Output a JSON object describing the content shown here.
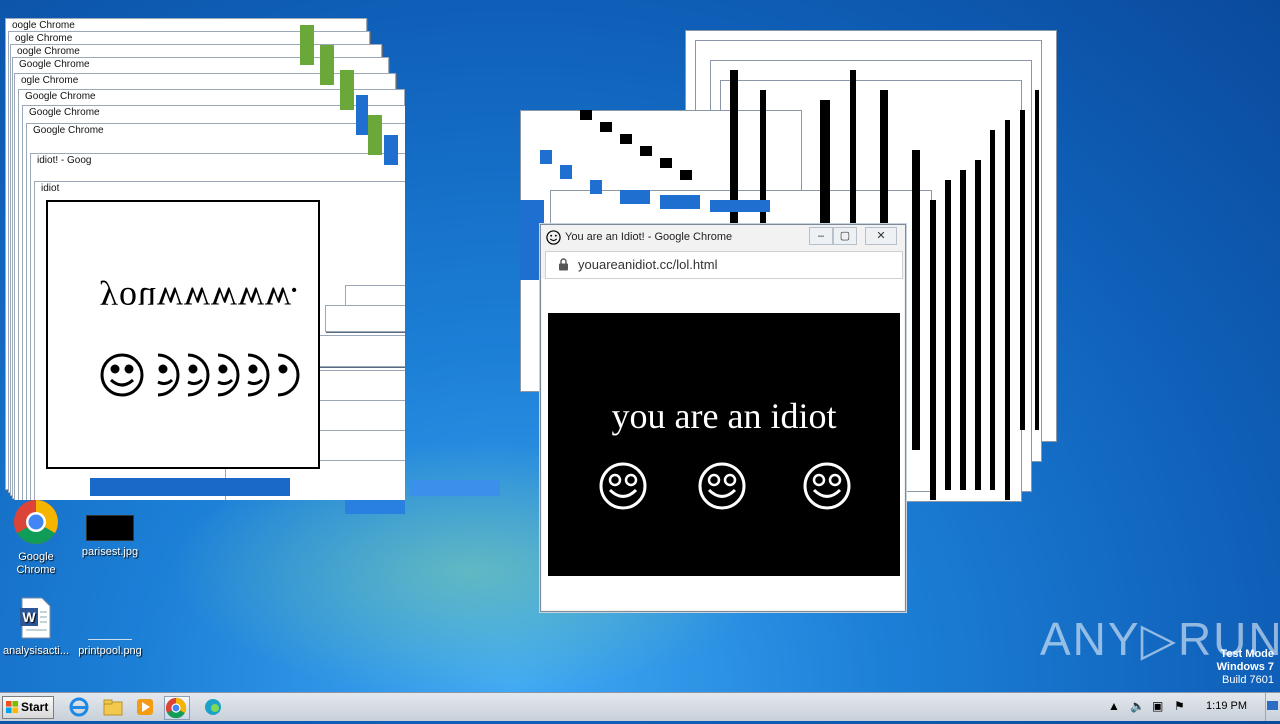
{
  "main_window": {
    "title": "You are an Idiot! - Google Chrome",
    "url": "youareanidiot.cc/lol.html",
    "headline": "you are an idiot",
    "minimize": "–",
    "maximize": "▢",
    "close": "✕"
  },
  "left_glitch": {
    "mirrored_text": "youwwwww.",
    "ghost_titles": [
      "Google Chrome",
      "oogle Chrome",
      "ogle Chrome",
      "oogle Chrome",
      "Google Chrome",
      "ogle Chrome",
      "Google Chrome",
      "Google Chrome",
      "idiot! - Goog",
      "idiot"
    ]
  },
  "desktop_icons": [
    {
      "label": "Google Chrome",
      "icon": "chrome-icon"
    },
    {
      "label": "parisest.jpg",
      "icon": "image-icon"
    },
    {
      "label": "analysisacti...",
      "icon": "word-doc-icon"
    },
    {
      "label": "printpool.png",
      "icon": "image-icon"
    }
  ],
  "watermark": {
    "brand": "ANY▷RUN",
    "mode": "Test Mode",
    "os": "Windows 7",
    "build": "Build 7601"
  },
  "taskbar": {
    "start_label": "Start",
    "clock": "1:19 PM",
    "pinned": [
      "ie-icon",
      "explorer-icon",
      "media-player-icon",
      "chrome-icon",
      "edge-icon"
    ]
  },
  "colors": {
    "desktop_blue": "#1c7fd6",
    "panel_black": "#000000",
    "text_white": "#ffffff"
  }
}
